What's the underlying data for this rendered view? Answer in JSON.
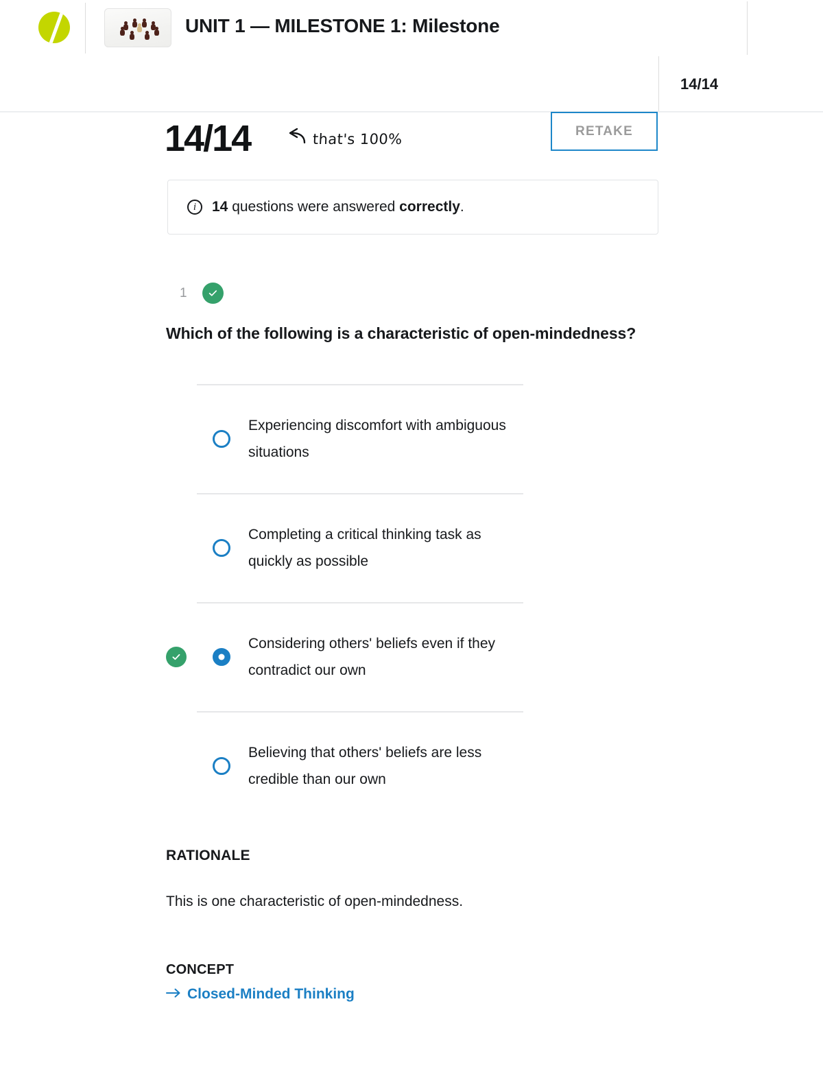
{
  "header": {
    "logo_icon": "sophia-logo-icon",
    "thumbnail_icon": "chess-pawns-thumbnail",
    "title": "UNIT 1 — MILESTONE 1: Milestone"
  },
  "score_strip": {
    "value": "14/14"
  },
  "score": {
    "big_value": "14/14",
    "annotation": "that's 100%",
    "annotation_icon": "curved-arrow-left-icon",
    "retake_label": "RETAKE"
  },
  "info_banner": {
    "icon": "info-circle-icon",
    "count": "14",
    "text_middle": " questions were answered ",
    "emphasis": "correctly",
    "text_end": "."
  },
  "question": {
    "number": "1",
    "status_icon": "check-circle-icon",
    "prompt": "Which of the following is a characteristic of open-mindedness?",
    "options": [
      {
        "label": "Experiencing discomfort with ambiguous situations",
        "selected": false,
        "correct": false
      },
      {
        "label": "Completing a critical thinking task as quickly as possible",
        "selected": false,
        "correct": false
      },
      {
        "label": "Considering others' beliefs even if they contradict our own",
        "selected": true,
        "correct": true
      },
      {
        "label": "Believing that others' beliefs are less credible than our own",
        "selected": false,
        "correct": false
      }
    ],
    "rationale_heading": "RATIONALE",
    "rationale_text": "This is one characteristic of open-mindedness.",
    "concept_heading": "CONCEPT",
    "concept_link": "Closed-Minded Thinking",
    "concept_link_icon": "arrow-right-icon"
  },
  "colors": {
    "brand_green": "#c3d600",
    "success_green": "#35a16b",
    "accent_blue": "#1b7fc4",
    "retake_border": "#1d87c9",
    "muted_text": "#97999c"
  }
}
